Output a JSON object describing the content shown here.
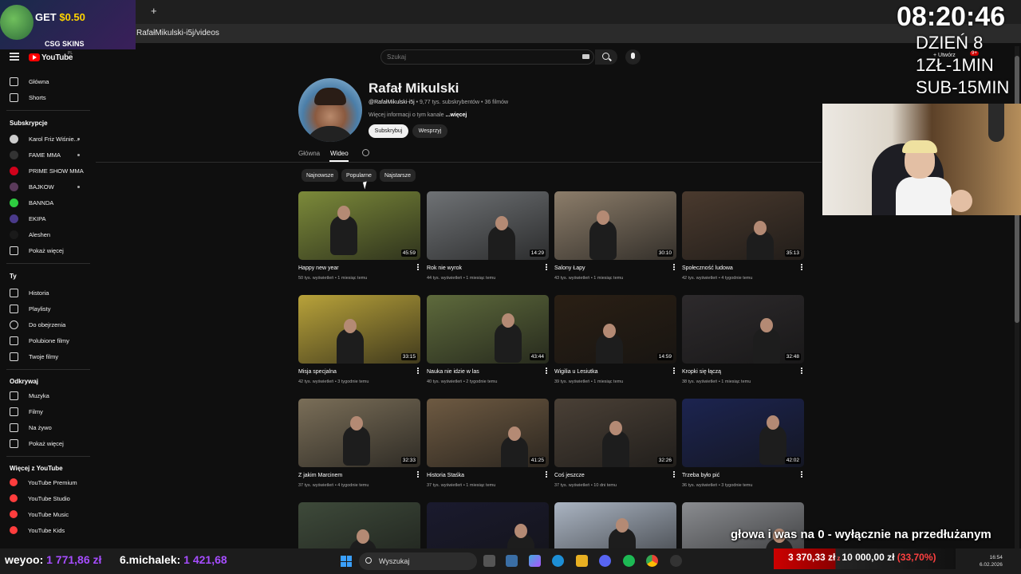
{
  "browser": {
    "url": "RafałMikulski-i5j/videos",
    "new_tab": "+"
  },
  "promo": {
    "get_prefix": "GET",
    "get_amount": "$0.50",
    "brand": "CSG SKINS"
  },
  "stream_overlay": {
    "clock": "08:20:46",
    "day_line": "DZIEŃ 8",
    "rate_line1": "1ZŁ-1MIN",
    "rate_line2": "SUB-15MIN",
    "subtitle": "głowa i was na 0 - wyłącznie na przedłużanym"
  },
  "youtube": {
    "logo_text": "YouTube",
    "logo_region": "PL",
    "search_placeholder": "Szukaj",
    "create_label": "+ Utwórz",
    "notif_badge": "9+"
  },
  "sidebar": {
    "main": [
      {
        "label": "Główna",
        "icon": "home-icon"
      },
      {
        "label": "Shorts",
        "icon": "shorts-icon"
      }
    ],
    "subs_title": "Subskrypcje",
    "subs": [
      {
        "label": "Karol Friz Wiśnie...",
        "color": "#cccccc",
        "dot": true
      },
      {
        "label": "FAME MMA",
        "color": "#333333",
        "dot": true
      },
      {
        "label": "PRIME SHOW MMA",
        "color": "#d0021b",
        "dot": false
      },
      {
        "label": "BAJKOW",
        "color": "#5a3a5a",
        "dot": true
      },
      {
        "label": "BANNDA",
        "color": "#2ecc40",
        "dot": false
      },
      {
        "label": "EKIPA",
        "color": "#4a3a8a",
        "dot": false
      },
      {
        "label": "Aleshen",
        "color": "#1a1a1a",
        "dot": false
      },
      {
        "label": "Pokaż więcej",
        "color": "",
        "dot": false
      }
    ],
    "you_title": "Ty",
    "you": [
      {
        "label": "Historia"
      },
      {
        "label": "Playlisty"
      },
      {
        "label": "Do obejrzenia"
      },
      {
        "label": "Polubione filmy"
      },
      {
        "label": "Twoje filmy"
      }
    ],
    "explore_title": "Odkrywaj",
    "explore": [
      {
        "label": "Muzyka"
      },
      {
        "label": "Filmy"
      },
      {
        "label": "Na żywo"
      },
      {
        "label": "Pokaż więcej"
      }
    ],
    "more_title": "Więcej z YouTube",
    "more": [
      {
        "label": "YouTube Premium"
      },
      {
        "label": "YouTube Studio"
      },
      {
        "label": "YouTube Music"
      },
      {
        "label": "YouTube Kids"
      }
    ]
  },
  "channel": {
    "name": "Rafał Mikulski",
    "handle": "@RafałMikulski-i5j",
    "stats": " • 9,77 tys. subskrybentów • 36 filmów",
    "more_info": "Więcej informacji o tym kanale ",
    "more_link": "...więcej",
    "subscribe_label": "Subskrybuj",
    "support_label": "Wesprzyj",
    "tabs": [
      "Główna",
      "Wideo"
    ],
    "chips": [
      "Najnowsze",
      "Popularne",
      "Najstarsze"
    ]
  },
  "videos": [
    {
      "title": "Happy new year",
      "meta": "50 tys. wyświetleń • 1 miesiąc temu",
      "duration": "45:59",
      "bg": "#7c8a3a"
    },
    {
      "title": "Rok nie wyrok",
      "meta": "44 tys. wyświetleń • 1 miesiąc temu",
      "duration": "14:29",
      "bg": "#6f7275"
    },
    {
      "title": "Salony Łapy",
      "meta": "43 tys. wyświetleń • 1 miesiąc temu",
      "duration": "30:10",
      "bg": "#8c7d6a"
    },
    {
      "title": "Społeczność ludowa",
      "meta": "42 tys. wyświetleń • 4 tygodnie temu",
      "duration": "35:13",
      "bg": "#4a3a2e"
    },
    {
      "title": "Misja specjalna",
      "meta": "42 tys. wyświetleń • 3 tygodnie temu",
      "duration": "33:15",
      "bg": "#b8a23a"
    },
    {
      "title": "Nauka nie idzie w las",
      "meta": "40 tys. wyświetleń • 2 tygodnie temu",
      "duration": "43:44",
      "bg": "#5e6a3c"
    },
    {
      "title": "Wigilia u Lesiutka",
      "meta": "39 tys. wyświetleń • 1 miesiąc temu",
      "duration": "14:59",
      "bg": "#2a1f14"
    },
    {
      "title": "Kropki się łączą",
      "meta": "38 tys. wyświetleń • 1 miesiąc temu",
      "duration": "32:48",
      "bg": "#2d2a2c"
    },
    {
      "title": "Z jakim Marcinem",
      "meta": "37 tys. wyświetleń • 4 tygodnie temu",
      "duration": "32:33",
      "bg": "#7a6e58"
    },
    {
      "title": "Historia Staśka",
      "meta": "37 tys. wyświetleń • 1 miesiąc temu",
      "duration": "41:25",
      "bg": "#6e5a42"
    },
    {
      "title": "Coś jeszcze",
      "meta": "37 tys. wyświetleń • 10 dni temu",
      "duration": "32:26",
      "bg": "#4a4036"
    },
    {
      "title": "Trzeba było pić",
      "meta": "36 tys. wyświetleń • 3 tygodnie temu",
      "duration": "42:02",
      "bg": "#1c2450"
    },
    {
      "title": "",
      "meta": "",
      "duration": "",
      "bg": "#3e4a3a"
    },
    {
      "title": "",
      "meta": "",
      "duration": "",
      "bg": "#1a1a2e"
    },
    {
      "title": "",
      "meta": "",
      "duration": "",
      "bg": "#aab4c2"
    },
    {
      "title": "",
      "meta": "",
      "duration": "",
      "bg": "#8a8c90"
    }
  ],
  "taskbar": {
    "donors": [
      {
        "name": "weyoo:",
        "amount": "1 771,86 zł"
      },
      {
        "name": "6.michalek:",
        "amount": "1 421,68"
      }
    ],
    "goal_current": "3 370,33 zł",
    "goal_sep": "z",
    "goal_target": "10 000,00 zł",
    "goal_percent": "(33,70%)",
    "goal_fraction": 0.337,
    "search_label": "Wyszukaj",
    "time": "16:54",
    "date": "6.02.2026"
  }
}
